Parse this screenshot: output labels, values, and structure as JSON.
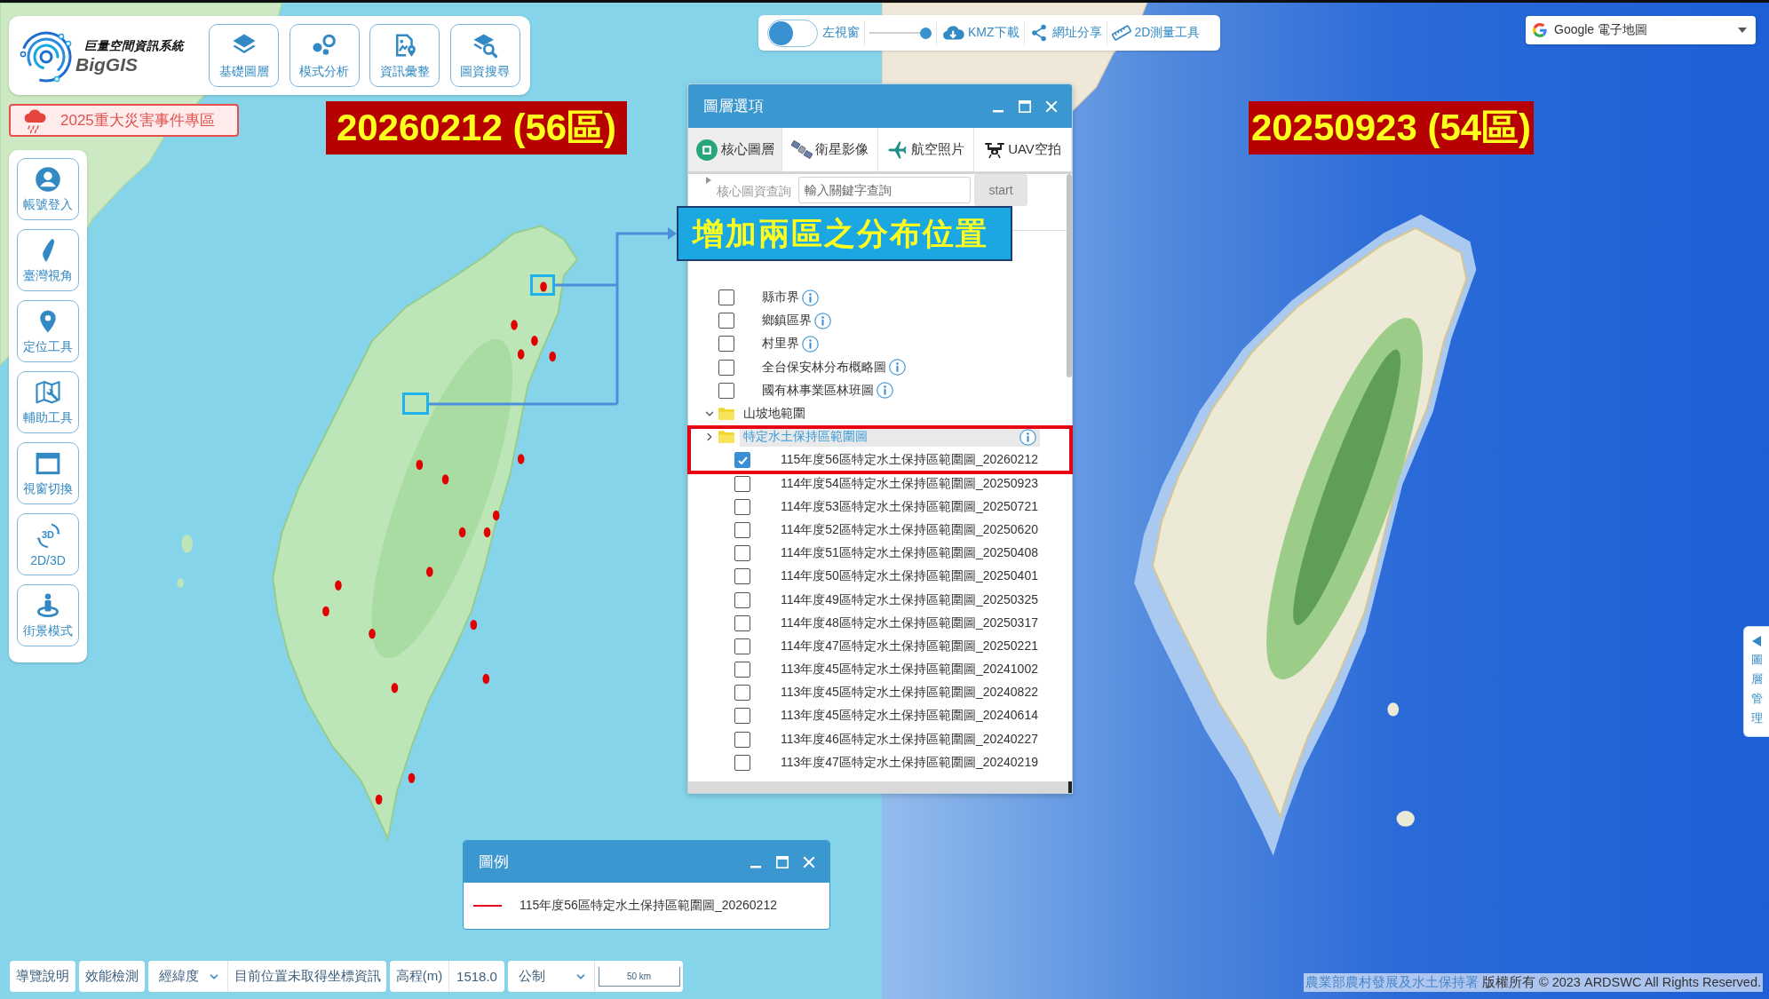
{
  "header": {
    "system_name": "巨量空間資訊系統",
    "brand": "BigGIS"
  },
  "main_toolbar": [
    {
      "label": "基礎圖層"
    },
    {
      "label": "模式分析"
    },
    {
      "label": "資訊彙整"
    },
    {
      "label": "圖資搜尋"
    }
  ],
  "event_banner": {
    "label": "2025重大災害事件專區"
  },
  "sidebar": [
    {
      "label": "帳號登入"
    },
    {
      "label": "臺灣視角"
    },
    {
      "label": "定位工具"
    },
    {
      "label": "輔助工具"
    },
    {
      "label": "視窗切換"
    },
    {
      "label": "2D/3D",
      "icon_text": "3D"
    },
    {
      "label": "街景模式"
    }
  ],
  "top_toolbar": {
    "split_view": {
      "label": "左視窗",
      "on": false
    },
    "slider": {
      "level": 1
    },
    "actions": [
      {
        "label": "KMZ下載"
      },
      {
        "label": "網址分享"
      },
      {
        "label": "2D測量工具"
      }
    ]
  },
  "basemap_select": {
    "value": "Google 電子地圖"
  },
  "map_annotations": {
    "left_date_label": "20260212 (56區)",
    "right_date_label": "20250923 (54區)",
    "callout": "增加兩區之分布位置"
  },
  "layer_panel": {
    "title": "圖層選項",
    "tabs": [
      {
        "label": "核心圖層",
        "selected": true
      },
      {
        "label": "衛星影像",
        "selected": false
      },
      {
        "label": "航空照片",
        "selected": false
      },
      {
        "label": "UAV空拍",
        "selected": false
      }
    ],
    "search": {
      "label": "核心圖資查詢",
      "placeholder": "輸入關鍵字查詢",
      "button": "start"
    },
    "layers": [
      {
        "kind": "layer",
        "label": "縣市界",
        "checked": false,
        "selected": false,
        "info": true
      },
      {
        "kind": "layer",
        "label": "鄉鎮區界",
        "checked": false,
        "selected": false,
        "info": true
      },
      {
        "kind": "layer",
        "label": "村里界",
        "checked": false,
        "selected": false,
        "info": true
      },
      {
        "kind": "layer",
        "label": "全台保安林分布概略圖",
        "checked": false,
        "selected": false,
        "info": true
      },
      {
        "kind": "layer",
        "label": "國有林事業區林班圖",
        "checked": false,
        "selected": false,
        "info": true
      },
      {
        "kind": "folder",
        "label": "山坡地範圍",
        "expanded": true,
        "selected": false,
        "info": false
      },
      {
        "kind": "folder",
        "label": "特定水土保持區範圍圖",
        "expanded": false,
        "selected": true,
        "info": true,
        "children": [
          {
            "label": "115年度56區特定水土保持區範圍圖_20260212",
            "checked": true
          },
          {
            "label": "114年度54區特定水土保持區範圍圖_20250923",
            "checked": false
          },
          {
            "label": "114年度53區特定水土保持區範圍圖_20250721",
            "checked": false
          },
          {
            "label": "114年度52區特定水土保持區範圍圖_20250620",
            "checked": false
          },
          {
            "label": "114年度51區特定水土保持區範圍圖_20250408",
            "checked": false
          },
          {
            "label": "114年度50區特定水土保持區範圍圖_20250401",
            "checked": false
          },
          {
            "label": "114年度49區特定水土保持區範圍圖_20250325",
            "checked": false
          },
          {
            "label": "114年度48區特定水土保持區範圍圖_20250317",
            "checked": false
          },
          {
            "label": "114年度47區特定水土保持區範圍圖_20250221",
            "checked": false
          },
          {
            "label": "113年度45區特定水土保持區範圍圖_20241002",
            "checked": false
          },
          {
            "label": "113年度45區特定水土保持區範圍圖_20240822",
            "checked": false
          },
          {
            "label": "113年度45區特定水土保持區範圍圖_20240614",
            "checked": false
          },
          {
            "label": "113年度46區特定水土保持區範圍圖_20240227",
            "checked": false
          },
          {
            "label": "113年度47區特定水土保持區範圍圖_20240219",
            "checked": false
          }
        ]
      }
    ]
  },
  "legend": {
    "title": "圖例",
    "items": [
      {
        "label": "115年度56區特定水土保持區範圍圖_20260212",
        "color": "#e3001b"
      }
    ]
  },
  "status_bar": {
    "guide_button": "導覽說明",
    "performance_button": "效能檢測",
    "coordinate_select": "經緯度",
    "position_text": "目前位置未取得坐標資訊",
    "elevation_label": "高程(m)",
    "elevation_value": "1518.0",
    "unit_select": "公制",
    "scale_label": "50 km"
  },
  "copyright": {
    "agency_link": "農業部農村發展及水土保持署",
    "notice": "版權所有 © 2023 ARDSWC All Rights Reserved."
  },
  "layer_manager_tab": {
    "label": "圖層管理"
  }
}
